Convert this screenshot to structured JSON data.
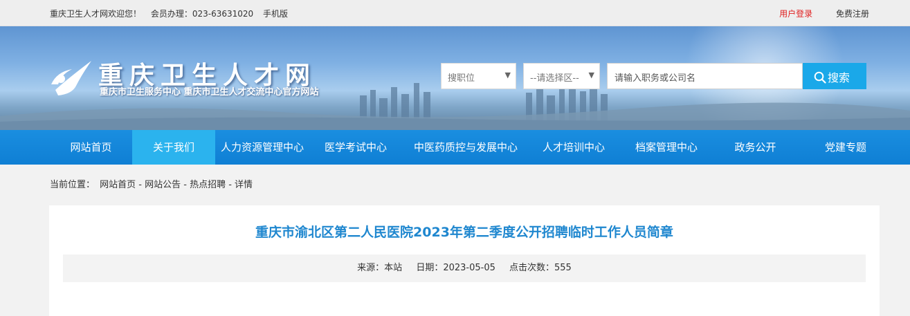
{
  "topbar": {
    "welcome": "重庆卫生人才网欢迎您！",
    "member": "会员办理：023-63631020",
    "mobile": "手机版",
    "login": "用户登录",
    "register": "免费注册"
  },
  "header": {
    "site_name": "重庆卫生人才网",
    "subtitle": "重庆市卫生服务中心 重庆市卫生人才交流中心官方网站"
  },
  "search": {
    "position_select": "搜职位",
    "region_select": "--请选择区--",
    "keyword_placeholder": "请输入职务或公司名",
    "button_label": "搜索"
  },
  "nav": {
    "items": [
      {
        "label": "网站首页"
      },
      {
        "label": "关于我们"
      },
      {
        "label": "人力资源管理中心"
      },
      {
        "label": "医学考试中心"
      },
      {
        "label": "中医药质控与发展中心"
      },
      {
        "label": "人才培训中心"
      },
      {
        "label": "档案管理中心"
      },
      {
        "label": "政务公开"
      },
      {
        "label": "党建专题"
      }
    ],
    "active_index": 1
  },
  "breadcrumb": {
    "label": "当前位置：",
    "path": "网站首页 - 网站公告 - 热点招聘 - 详情"
  },
  "article": {
    "title": "重庆市渝北区第二人民医院2023年第二季度公开招聘临时工作人员简章",
    "source": "来源：本站",
    "date": "日期：2023-05-05",
    "views": "点击次数：555"
  },
  "colors": {
    "nav_bg": "#1a8ee0",
    "nav_active": "#2bb3ee",
    "accent_title": "#1f87cf",
    "login_red": "#e02020",
    "search_button": "#1aa8e9"
  }
}
